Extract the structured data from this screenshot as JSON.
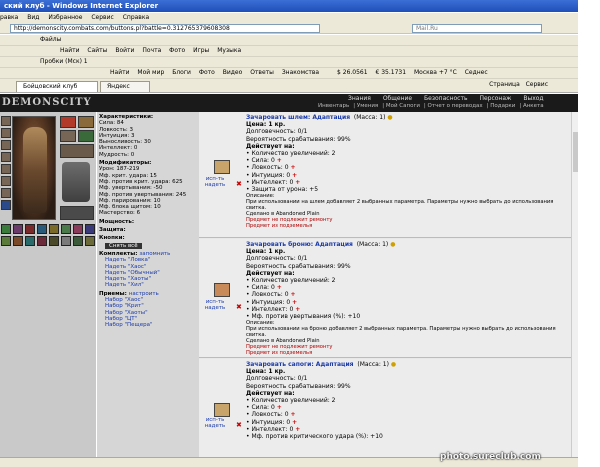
{
  "browser": {
    "title": "ский клуб - Windows Internet Explorer",
    "menu": [
      "равка",
      "Вид",
      "Избранное",
      "Сервис",
      "Справка"
    ],
    "url": "http://demonscity.combats.com/buttons.pl?battle=0.312765379608308",
    "search_placeholder": "Mail.Ru",
    "toolbar1": [
      "Файлы",
      "Найти",
      "Сайты",
      "Войти",
      "Почта",
      "Фото",
      "Игры",
      "Музыка"
    ],
    "toolbar2": [
      "Найти",
      "Мой мир",
      "Блоги",
      "Фото",
      "Видео",
      "Ответы",
      "Знакомства"
    ],
    "toolbar_right": [
      "$ 26.0561",
      "€ 35.1731",
      "Москва +7 °С",
      "Седнес"
    ],
    "probki": "Пробки (Мск) 1",
    "tabs": [
      "Бойцовский клуб",
      "Яндекс"
    ],
    "page_btn": "Страница",
    "service_btn": "Сервис"
  },
  "game": {
    "logo": "DEMONSCITY",
    "nav": [
      "Знания",
      "Общение",
      "Безопасность",
      "Персонаж",
      "Выход"
    ],
    "subnav": [
      "Инвентарь",
      "Умения",
      "Мой Сапоги",
      "Отчет о переводах",
      "Подарки",
      "Анкета"
    ]
  },
  "stats": {
    "char_header": "Характеристики:",
    "char": [
      "Сила: 84",
      "Ловкость: 3",
      "Интуиция: 3",
      "Выносливость: 30",
      "Интеллект: 0",
      "Мудрость: 0"
    ],
    "mod_header": "Модификаторы:",
    "mods": [
      "Урон: 187-219",
      "Мф. крит. удара: 15",
      "Мф. против крит. удара: 625",
      "Мф. увертывания: -50",
      "Мф. против увертывания: 245",
      "Мф. парирования: 10",
      "Мф. блока щитом: 10",
      "Мастерство: 6"
    ],
    "power_header": "Мощность:",
    "defense_header": "Защита:",
    "buttons_header": "Кнопки:",
    "remove_btn": "Снять всё",
    "sets_header": "Комплекты:",
    "sets_remember": "запомнить",
    "sets": [
      "Надеть \"Ловка\"",
      "Надеть \"Хаос\"",
      "Надеть \"Обычный\"",
      "Надеть \"Хаоты\"",
      "Надеть \"Хил\""
    ],
    "tricks_header": "Приемы:",
    "tricks_setup": "настроить",
    "tricks": [
      "Набор \"Хаос\"",
      "Набор \"Крит\"",
      "Набор \"Хаоты\"",
      "Набор \"ЦТ\"",
      "Набор \"Пещера\""
    ]
  },
  "items": [
    {
      "name": "Зачаровать шлем: Адаптация",
      "mass": "(Масса: 1)",
      "use": "исп-ть",
      "wear": "надеть",
      "lines": [
        "Цена: 1 кр.",
        "Долговечность: 0/1",
        "Вероятность срабатывания: 99%",
        "Действует на:",
        "• Количество увеличений: 2",
        "• Сила: 0",
        "• Ловкость: 0",
        "• Интуиция: 0",
        "• Интеллект: 0",
        "• Защита от урона: +5"
      ],
      "desc_label": "Описание:",
      "desc": "При использовании на шлем добавляет 2 выбранных параметра. Параметры нужно выбрать до использования свитка.",
      "made": "Сделано в Abandoned Plain",
      "warn1": "Предмет не подлежит ремонту",
      "warn2": "Предмет из подземелья"
    },
    {
      "name": "Зачаровать броню: Адаптация",
      "mass": "(Масса: 1)",
      "use": "исп-ть",
      "wear": "надеть",
      "lines": [
        "Цена: 1 кр.",
        "Долговечность: 0/1",
        "Вероятность срабатывания: 99%",
        "Действует на:",
        "• Количество увеличений: 2",
        "• Сила: 0",
        "• Ловкость: 0",
        "• Интуиция: 0",
        "• Интеллект: 0",
        "• Мф. против увертывания (%): +10"
      ],
      "desc_label": "Описание:",
      "desc": "При использовании на броню добавляет 2 выбранных параметра. Параметры нужно выбрать до использования свитка.",
      "made": "Сделано в Abandoned Plain",
      "warn1": "Предмет не подлежит ремонту",
      "warn2": "Предмет из подземелья"
    },
    {
      "name": "Зачаровать сапоги: Адаптация",
      "mass": "(Масса: 1)",
      "use": "исп-ть",
      "wear": "надеть",
      "lines": [
        "Цена: 1 кр.",
        "Долговечность: 0/1",
        "Вероятность срабатывания: 99%",
        "Действует на:",
        "• Количество увеличений: 2",
        "• Сила: 0",
        "• Ловкость: 0",
        "• Интуиция: 0",
        "• Интеллект: 0",
        "• Мф. против критического удара (%): +10"
      ]
    }
  ],
  "watermark": "photo.sureclub.com"
}
